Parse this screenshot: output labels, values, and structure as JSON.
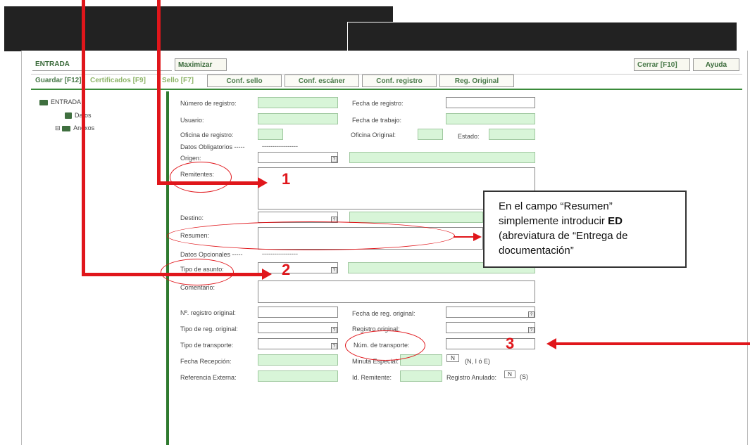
{
  "topbar": {
    "entrada": "ENTRADA",
    "maximizar": "Maximizar",
    "cerrar": "Cerrar [F10]",
    "ayuda": "Ayuda"
  },
  "toolbar": {
    "guardar": "Guardar [F12]",
    "certificados": "Certificados [F9]",
    "sello": "Sello [F7]",
    "conf_sello": "Conf. sello",
    "conf_escaner": "Conf. escáner",
    "conf_registro": "Conf. registro",
    "reg_original": "Reg. Original"
  },
  "tree": {
    "root": "ENTRADA",
    "datos": "Datos",
    "anexos": "Anexos",
    "expander": "⊟"
  },
  "form": {
    "numero_registro": "Número de registro:",
    "fecha_registro": "Fecha de registro:",
    "usuario": "Usuario:",
    "fecha_trabajo": "Fecha de trabajo:",
    "oficina_registro": "Oficina de registro:",
    "oficina_original": "Oficina Original:",
    "estado": "Estado:",
    "datos_obligatorios": "Datos Obligatorios -----",
    "datos_obligatorios_line": "-----------------",
    "origen": "Origen:",
    "remitentes": "Remitentes:",
    "destino": "Destino:",
    "resumen": "Resumen:",
    "datos_opcionales": "Datos Opcionales -----",
    "datos_opcionales_line": "-----------------",
    "tipo_asunto": "Tipo de asunto:",
    "comentario": "Comentario:",
    "n_registro_original": "Nº. registro original:",
    "fecha_reg_original": "Fecha de reg. original:",
    "tipo_reg_original": "Tipo de reg. original:",
    "registro_original": "Registro original:",
    "tipo_transporte": "Tipo de transporte:",
    "num_transporte": "Núm. de transporte:",
    "fecha_recepcion": "Fecha Recepción:",
    "minuta_especial": "Minuta Especial:",
    "minuta_value": "N",
    "minuta_hint": "(N, I ó E)",
    "referencia_externa": "Referencia Externa:",
    "id_remitente": "Id. Remitente:",
    "registro_anulado": "Registro Anulado:",
    "anulado_value": "N",
    "anulado_hint": "(S)",
    "lookup_glyph": "?"
  },
  "annotations": {
    "num1": "1",
    "num2": "2",
    "num3": "3",
    "note_line1": "En el campo “Resumen”",
    "note_line2_pre": "simplemente introducir ",
    "note_line2_bold": "ED",
    "note_line3": "(abreviatura de “Entrega de",
    "note_line4": "documentación”"
  },
  "colors": {
    "accent_red": "#e0161b",
    "field_green": "#d8f5d8",
    "frame_green": "#2f7a2f"
  }
}
